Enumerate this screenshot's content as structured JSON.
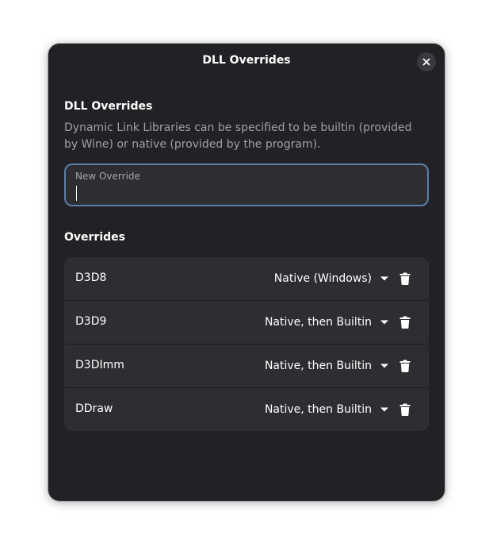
{
  "window": {
    "title": "DLL Overrides",
    "close_icon": "close-icon"
  },
  "intro": {
    "heading": "DLL Overrides",
    "description": "Dynamic Link Libraries can be specified to be builtin (provided by Wine) or native (provided by the program)."
  },
  "new_override": {
    "label": "New Override",
    "value": ""
  },
  "overrides": {
    "heading": "Overrides",
    "items": [
      {
        "name": "D3D8",
        "mode": "Native (Windows)"
      },
      {
        "name": "D3D9",
        "mode": "Native, then Builtin"
      },
      {
        "name": "D3DImm",
        "mode": "Native, then Builtin"
      },
      {
        "name": "DDraw",
        "mode": "Native, then Builtin"
      }
    ]
  },
  "colors": {
    "dialog_bg": "#222226",
    "card_bg": "#2e2e32",
    "focus_border": "#5a7fa8",
    "dim_text": "#a0a0a4"
  }
}
